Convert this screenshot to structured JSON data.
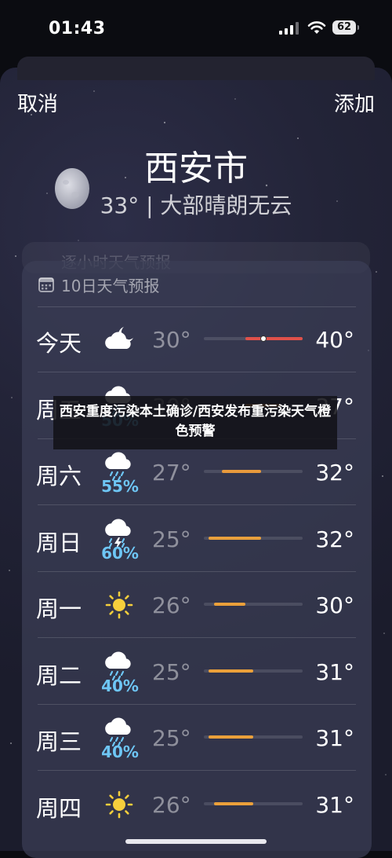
{
  "status_bar": {
    "time": "01:43",
    "battery": "62"
  },
  "nav": {
    "cancel_label": "取消",
    "add_label": "添加"
  },
  "location": {
    "city": "西安市",
    "summary": "33° | 大部晴朗无云"
  },
  "hidden_card": {
    "label": "逐小时天气预报"
  },
  "forecast": {
    "header": "10日天气预报",
    "days": [
      {
        "day": "今天",
        "icon": "partly-cloudy-night-icon",
        "precip": "",
        "low": "30°",
        "high": "40°",
        "bar_start": 0.42,
        "bar_end": 1.0,
        "bar_color": "#e0514a",
        "current": 0.6
      },
      {
        "day": "周五",
        "icon": "rain-cloud-icon",
        "precip": "50%",
        "low": "30°",
        "high": "37°",
        "bar_start": 0.42,
        "bar_end": 0.78,
        "bar_color": "#e78a3c"
      },
      {
        "day": "周六",
        "icon": "rain-cloud-icon",
        "precip": "55%",
        "low": "27°",
        "high": "32°",
        "bar_start": 0.18,
        "bar_end": 0.58,
        "bar_color": "#e89a3c"
      },
      {
        "day": "周日",
        "icon": "thunderstorm-icon",
        "precip": "60%",
        "low": "25°",
        "high": "32°",
        "bar_start": 0.05,
        "bar_end": 0.58,
        "bar_color": "#e8a03c"
      },
      {
        "day": "周一",
        "icon": "sun-icon",
        "precip": "",
        "low": "26°",
        "high": "30°",
        "bar_start": 0.1,
        "bar_end": 0.42,
        "bar_color": "#eba03a"
      },
      {
        "day": "周二",
        "icon": "rain-cloud-icon",
        "precip": "40%",
        "low": "25°",
        "high": "31°",
        "bar_start": 0.05,
        "bar_end": 0.5,
        "bar_color": "#eba03a"
      },
      {
        "day": "周三",
        "icon": "rain-cloud-icon",
        "precip": "40%",
        "low": "25°",
        "high": "31°",
        "bar_start": 0.05,
        "bar_end": 0.5,
        "bar_color": "#eba03a"
      },
      {
        "day": "周四",
        "icon": "sun-icon",
        "precip": "",
        "low": "26°",
        "high": "31°",
        "bar_start": 0.1,
        "bar_end": 0.5,
        "bar_color": "#eba03a"
      }
    ]
  },
  "overlay_banner": {
    "text": "西安重度污染本土确诊/西安发布重污染天气橙色预警"
  }
}
